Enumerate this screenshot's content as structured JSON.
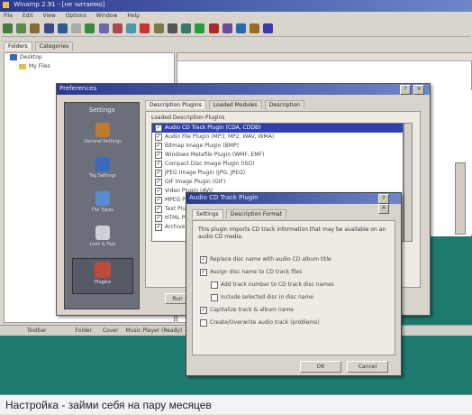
{
  "caption": "Настройка - займи себя на пару месяцев",
  "main_window": {
    "title": "Winamp 2.91 - [не читаемо]",
    "menu": [
      "File",
      "Edit",
      "View",
      "Options",
      "Window",
      "Help"
    ]
  },
  "left_tabs": [
    "Folders",
    "Categories"
  ],
  "tree": {
    "root": "Desktop",
    "child": "My Files"
  },
  "prefs_dialog": {
    "title": "Preferences",
    "sidebar_header": "Settings",
    "sidebar_items": [
      "General Settings",
      "Tag Settings",
      "File Types",
      "Look & Feel",
      "Plugins"
    ],
    "tabs": [
      "Description Plugins",
      "Loaded Modules",
      "Description"
    ],
    "list_label": "Loaded Description Plugins",
    "list_rows": [
      "Audio CD Track Plugin (CDA, CDDB)",
      "Audio File Plugin (MP3, MP2, WAV, WMA)",
      "Bitmap Image Plugin (BMP)",
      "Windows Metafile Plugin (WMF, EMF)",
      "Compact Disc Image Plugin (ISO)",
      "JPEG Image Plugin (JPG, JPEG)",
      "GIF Image Plugin (GIF)",
      "Video Plugin (AVI)",
      "MPEG Plugin (MPG)",
      "Text Plugin (TXT)",
      "HTML Plugin (HTM)",
      "Archive Plugin (ZIP)"
    ],
    "ok_button": "Run"
  },
  "plugin_dialog": {
    "title": "Audio CD Track Plugin",
    "tabs": [
      "Settings",
      "Description Format"
    ],
    "description": "This plugin imports CD track information that may be available on an audio CD media.",
    "options": [
      {
        "label": "Replace disc name with audio CD album title",
        "checked": true,
        "indent": false
      },
      {
        "label": "Assign disc name to CD track files",
        "checked": true,
        "indent": false
      },
      {
        "label": "Add track number to CD track disc names",
        "checked": false,
        "indent": true
      },
      {
        "label": "Include selected disc in disc name",
        "checked": false,
        "indent": true
      },
      {
        "label": "Capitalize track & album name",
        "checked": true,
        "indent": false
      },
      {
        "label": "Create/Overwrite audio track (problems)",
        "checked": false,
        "indent": false
      }
    ],
    "ok": "OK",
    "cancel": "Cancel"
  },
  "status_bar": [
    "Toolbar",
    "Folder",
    "Cover",
    "Music Player (Ready)"
  ],
  "colors": {
    "titlebar": "#2a3a8c",
    "selection": "#3040b0",
    "desktop_teal": "#1e7a6e",
    "caption_bg": "#f2f2f2"
  }
}
